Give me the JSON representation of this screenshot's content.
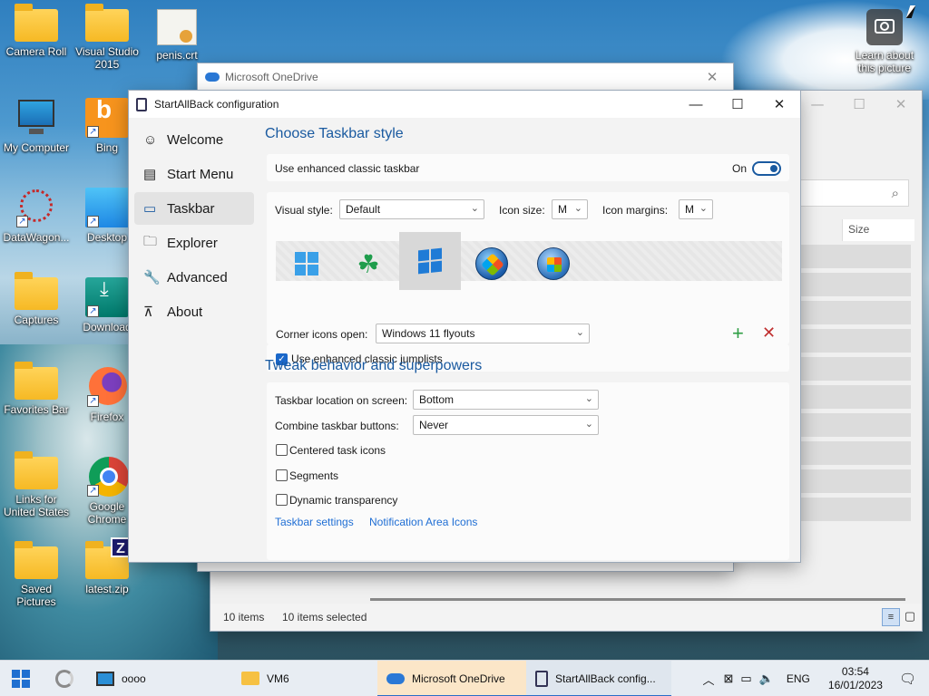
{
  "desktop": {
    "icons": [
      {
        "label": "Camera Roll"
      },
      {
        "label": "Visual Studio 2015"
      },
      {
        "label": "penis.crt"
      },
      {
        "label": "My Computer"
      },
      {
        "label": "Bing"
      },
      {
        "label": "DataWagon..."
      },
      {
        "label": "Desktop"
      },
      {
        "label": "Captures"
      },
      {
        "label": "Download"
      },
      {
        "label": "Favorites Bar"
      },
      {
        "label": "Firefox"
      },
      {
        "label": "Links for United States"
      },
      {
        "label": "Google Chrome"
      },
      {
        "label": "Saved Pictures"
      },
      {
        "label": "latest.zip"
      }
    ],
    "spotlight_label": "Learn about this picture"
  },
  "onedrive_window": {
    "title": "Microsoft OneDrive"
  },
  "explorer_window": {
    "column_size": "Size",
    "status_items": "10 items",
    "status_selected": "10 items selected"
  },
  "sab": {
    "title": "StartAllBack configuration",
    "nav": [
      {
        "label": "Welcome",
        "icon": "smile-icon"
      },
      {
        "label": "Start Menu",
        "icon": "start-menu-icon"
      },
      {
        "label": "Taskbar",
        "icon": "taskbar-icon"
      },
      {
        "label": "Explorer",
        "icon": "folder-icon"
      },
      {
        "label": "Advanced",
        "icon": "wrench-icon"
      },
      {
        "label": "About",
        "icon": "about-icon"
      }
    ],
    "section1_title": "Choose Taskbar style",
    "enhanced_label": "Use enhanced classic taskbar",
    "toggle_state": "On",
    "visual_style_label": "Visual style:",
    "visual_style_value": "Default",
    "icon_size_label": "Icon size:",
    "icon_size_value": "M",
    "icon_margins_label": "Icon margins:",
    "icon_margins_value": "M",
    "corner_label": "Corner icons open:",
    "corner_value": "Windows 11 flyouts",
    "jumplists_label": "Use enhanced classic jumplists",
    "section2_title": "Tweak behavior and superpowers",
    "location_label": "Taskbar location on screen:",
    "location_value": "Bottom",
    "combine_label": "Combine taskbar buttons:",
    "combine_value": "Never",
    "centered_label": "Centered task icons",
    "segments_label": "Segments",
    "dynamic_label": "Dynamic transparency",
    "link_taskbar": "Taskbar settings",
    "link_notif": "Notification Area Icons"
  },
  "taskbar": {
    "items": [
      {
        "label": "oooo"
      },
      {
        "label": "VM6"
      },
      {
        "label": "Microsoft OneDrive"
      },
      {
        "label": "StartAllBack config..."
      }
    ],
    "lang": "ENG",
    "time": "03:54",
    "date": "16/01/2023"
  },
  "colors": {
    "accent": "#1a5aa0",
    "link": "#1f6ed4",
    "check": "#1a67c9"
  }
}
